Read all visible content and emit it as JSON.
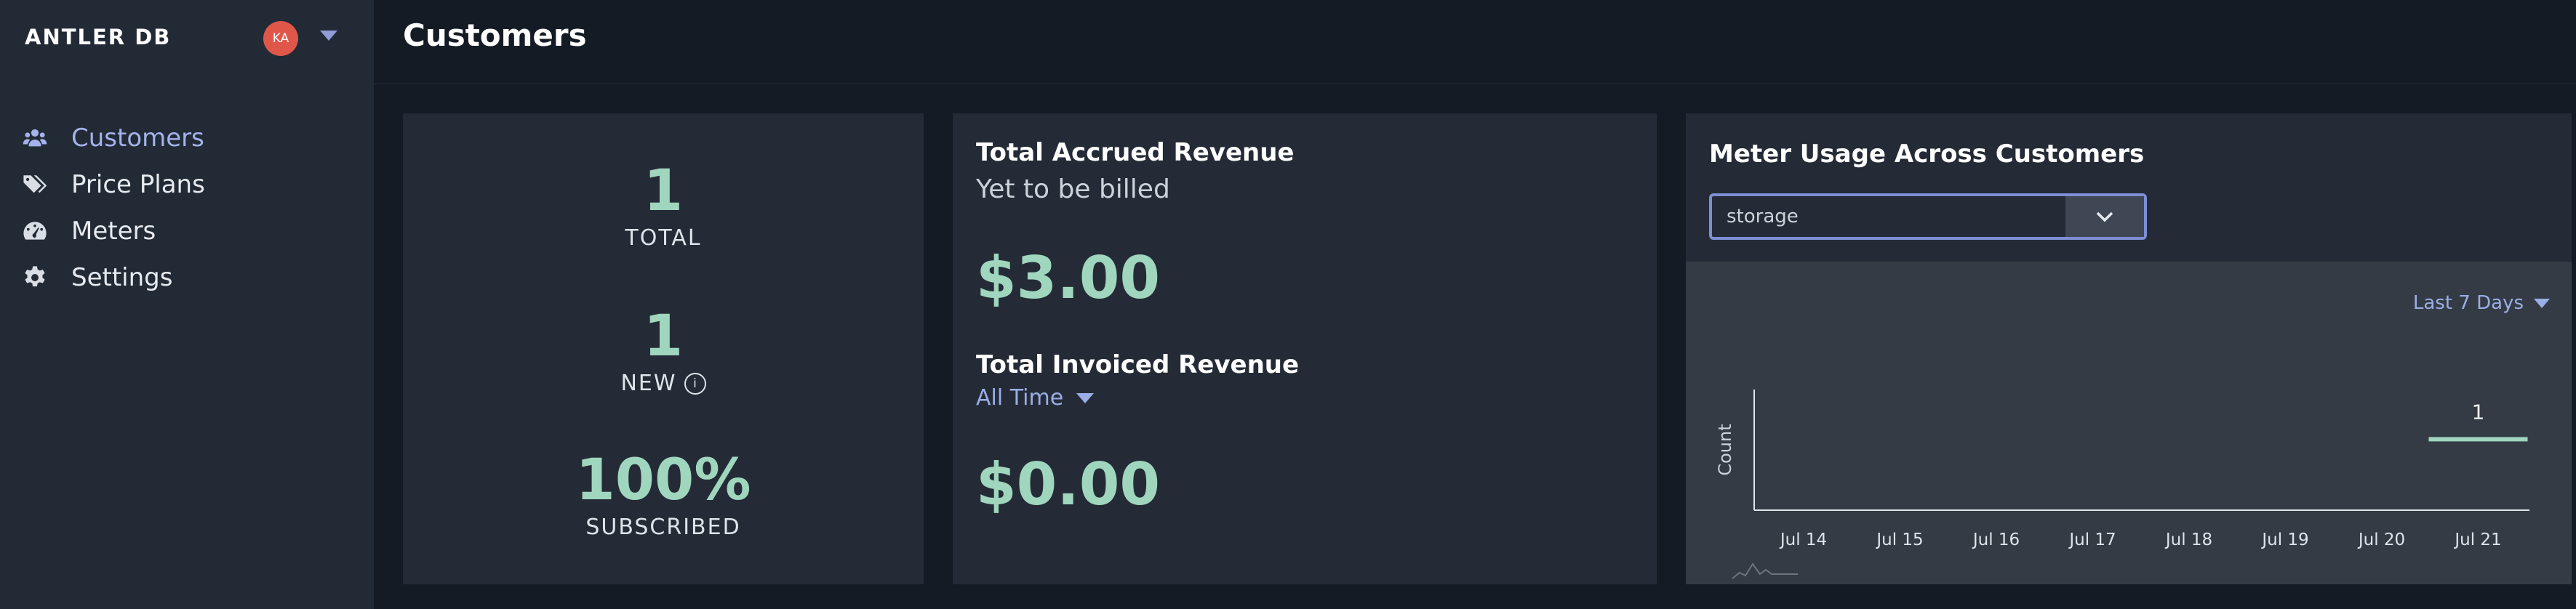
{
  "sidebar": {
    "brand": "ANTLER DB",
    "avatar_initials": "KA",
    "items": [
      {
        "label": "Customers",
        "icon": "users-icon",
        "active": true
      },
      {
        "label": "Price Plans",
        "icon": "tags-icon",
        "active": false
      },
      {
        "label": "Meters",
        "icon": "gauge-icon",
        "active": false
      },
      {
        "label": "Settings",
        "icon": "gear-icon",
        "active": false
      }
    ]
  },
  "header": {
    "title": "Customers"
  },
  "stats": {
    "total_value": "1",
    "total_label": "TOTAL",
    "new_value": "1",
    "new_label": "NEW",
    "subscribed_value": "100%",
    "subscribed_label": "SUBSCRIBED"
  },
  "revenue": {
    "accrued_title": "Total Accrued Revenue",
    "accrued_subtitle": "Yet to be billed",
    "accrued_amount": "$3.00",
    "invoiced_title": "Total Invoiced Revenue",
    "invoiced_period": "All Time",
    "invoiced_amount": "$0.00"
  },
  "meter": {
    "title": "Meter Usage Across Customers",
    "selected_meter": "storage",
    "range_label": "Last 7 Days"
  },
  "colors": {
    "accent": "#9aaee6",
    "value_green": "#9fd6bd",
    "avatar": "#e0574a"
  },
  "chart_data": {
    "type": "line",
    "categories": [
      "Jul 14",
      "Jul 15",
      "Jul 16",
      "Jul 17",
      "Jul 18",
      "Jul 19",
      "Jul 20",
      "Jul 21"
    ],
    "series": [
      {
        "values": [
          null,
          null,
          null,
          null,
          null,
          null,
          null,
          1
        ]
      }
    ],
    "data_labels": [
      "1"
    ],
    "xlabel": "",
    "ylabel": "Count",
    "grid": false,
    "legend": "none"
  }
}
